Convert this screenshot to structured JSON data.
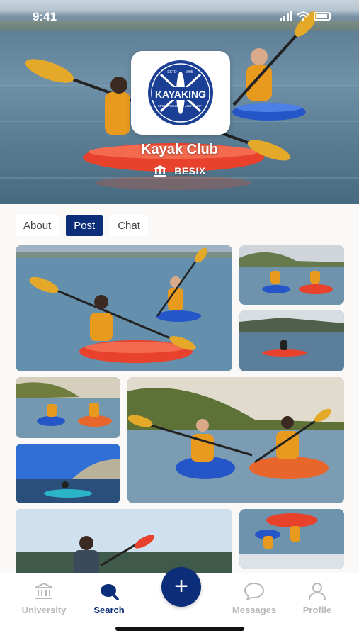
{
  "status": {
    "time": "9:41"
  },
  "club": {
    "name": "Kayak Club",
    "company": "BESIX",
    "logo": {
      "top": "ESTD",
      "year": "1995",
      "word": "KAYAKING",
      "tagline_left": "SPORT CLUB",
      "tagline_right": "AND CAMP"
    }
  },
  "tabs": [
    {
      "label": "About",
      "active": false
    },
    {
      "label": "Post",
      "active": true
    },
    {
      "label": "Chat",
      "active": false
    }
  ],
  "nav": {
    "items": [
      {
        "label": "University",
        "icon": "university-icon",
        "active": false
      },
      {
        "label": "Search",
        "icon": "search-icon",
        "active": true
      },
      {
        "label": "Messages",
        "icon": "chat-bubble-icon",
        "active": false
      },
      {
        "label": "Profile",
        "icon": "profile-icon",
        "active": false
      }
    ],
    "fab": "+"
  },
  "colors": {
    "accent": "#0b2d7a",
    "inactive": "#b8b8b8",
    "kayak_red": "#e8412c",
    "kayak_blue": "#2556c7",
    "vest": "#e89a1f"
  }
}
